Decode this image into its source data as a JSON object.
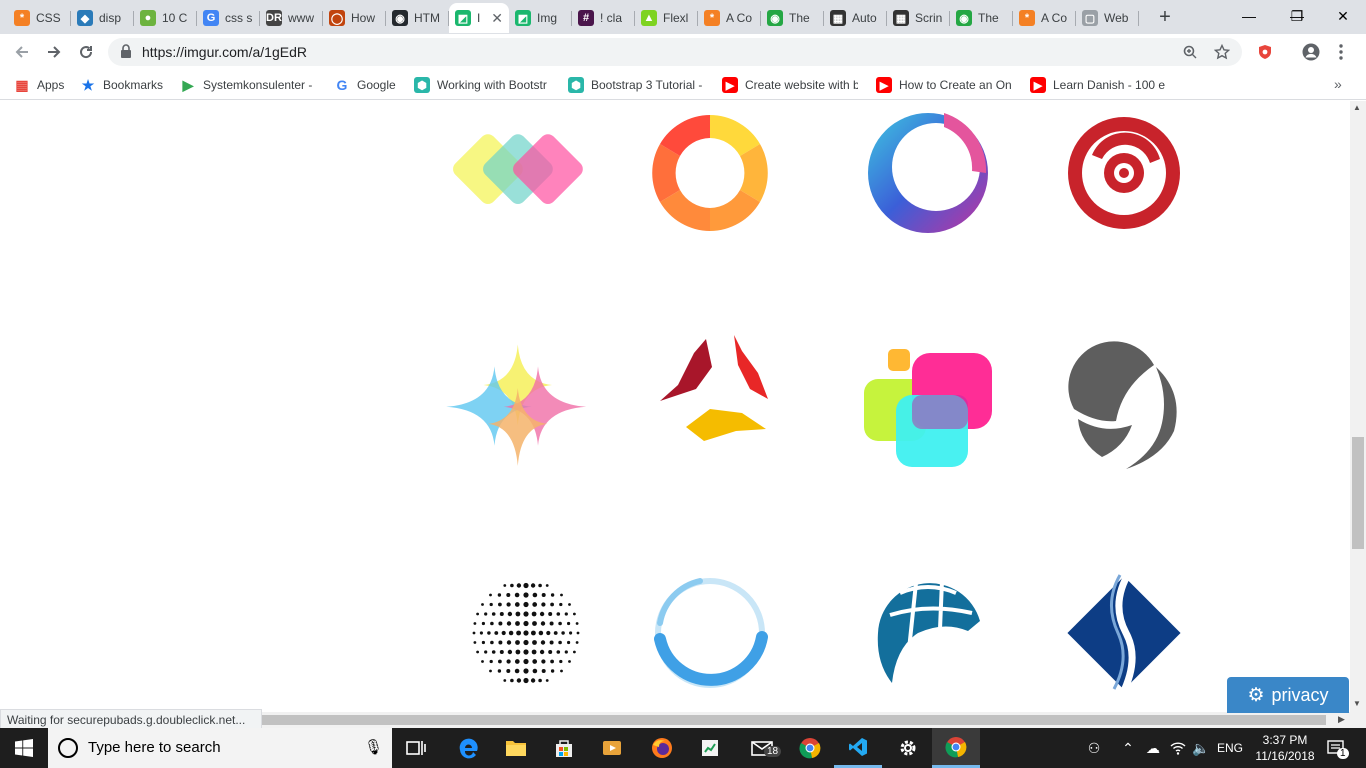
{
  "browser": {
    "tabs": [
      {
        "title": "CSS",
        "fav": "*",
        "color": "#f48024"
      },
      {
        "title": "disp",
        "fav": "◆",
        "color": "#2b7bb9"
      },
      {
        "title": "10 C",
        "fav": "●",
        "color": "#6db33f"
      },
      {
        "title": "css s",
        "fav": "G",
        "color": "#4285f4"
      },
      {
        "title": "www",
        "fav": "DR",
        "color": "#444444"
      },
      {
        "title": "How",
        "fav": "◯",
        "color": "#c1440e"
      },
      {
        "title": "HTM",
        "fav": "◉",
        "color": "#24292e"
      },
      {
        "title": "I",
        "fav": "◩",
        "color": "#1bb76e"
      },
      {
        "title": "Img",
        "fav": "◩",
        "color": "#1bb76e"
      },
      {
        "title": "! cla",
        "fav": "#",
        "color": "#4a154b"
      },
      {
        "title": "Flexl",
        "fav": "▲",
        "color": "#7ed321"
      },
      {
        "title": "A Co",
        "fav": "*",
        "color": "#f48024"
      },
      {
        "title": "The",
        "fav": "◉",
        "color": "#25a744"
      },
      {
        "title": "Auto",
        "fav": "▦",
        "color": "#333333"
      },
      {
        "title": "Scrin",
        "fav": "▦",
        "color": "#333333"
      },
      {
        "title": "The",
        "fav": "◉",
        "color": "#25a744"
      },
      {
        "title": "A Co",
        "fav": "*",
        "color": "#f48024"
      },
      {
        "title": "Web",
        "fav": "▢",
        "color": "#9aa0a6"
      }
    ],
    "active_tab_close": "✕",
    "new_tab": "+",
    "window_controls": {
      "minimize": "—",
      "maximize": "❐",
      "close": "✕"
    },
    "url": "https://imgur.com/a/1gEdR",
    "bookmarks": [
      {
        "label": "Apps",
        "icon": "apps-grid-icon",
        "color": "#e8453c"
      },
      {
        "label": "Bookmarks",
        "icon": "star-icon",
        "color": "#1a73e8"
      },
      {
        "label": "Systemkonsulenter -",
        "icon": "play-store-icon",
        "color": "#34a853"
      },
      {
        "label": "Google",
        "icon": "google-icon",
        "color": "#4285f4"
      },
      {
        "label": "Working with Bootstr",
        "icon": "bootstrap-icon",
        "color": "#2ab7a9"
      },
      {
        "label": "Bootstrap 3 Tutorial -",
        "icon": "bootstrap-icon",
        "color": "#2ab7a9"
      },
      {
        "label": "Create website with b",
        "icon": "youtube-icon",
        "color": "#ff0000"
      },
      {
        "label": "How to Create an On",
        "icon": "youtube-icon",
        "color": "#ff0000"
      },
      {
        "label": "Learn Danish - 100 e",
        "icon": "youtube-icon",
        "color": "#ff0000"
      }
    ],
    "bookmarks_more": "»"
  },
  "page": {
    "status_text": "Waiting for securepubads.g.doubleclick.net...",
    "privacy_label": "privacy",
    "logos": [
      "overlapping-diamonds-logo",
      "swirl-ring-logo",
      "gradient-crescent-logo",
      "red-target-logo",
      "four-point-sparkle-logo",
      "brush-stroke-logo",
      "colored-squares-logo",
      "gray-swoosh-logo",
      "dotted-sphere-logo",
      "blue-brush-circle-logo",
      "blue-globe-logo",
      "blue-diamond-logo"
    ]
  },
  "taskbar": {
    "search_placeholder": "Type here to search",
    "mail_badge": "18",
    "language": "ENG",
    "time": "3:37 PM",
    "date": "11/16/2018",
    "notification_count": "1"
  }
}
